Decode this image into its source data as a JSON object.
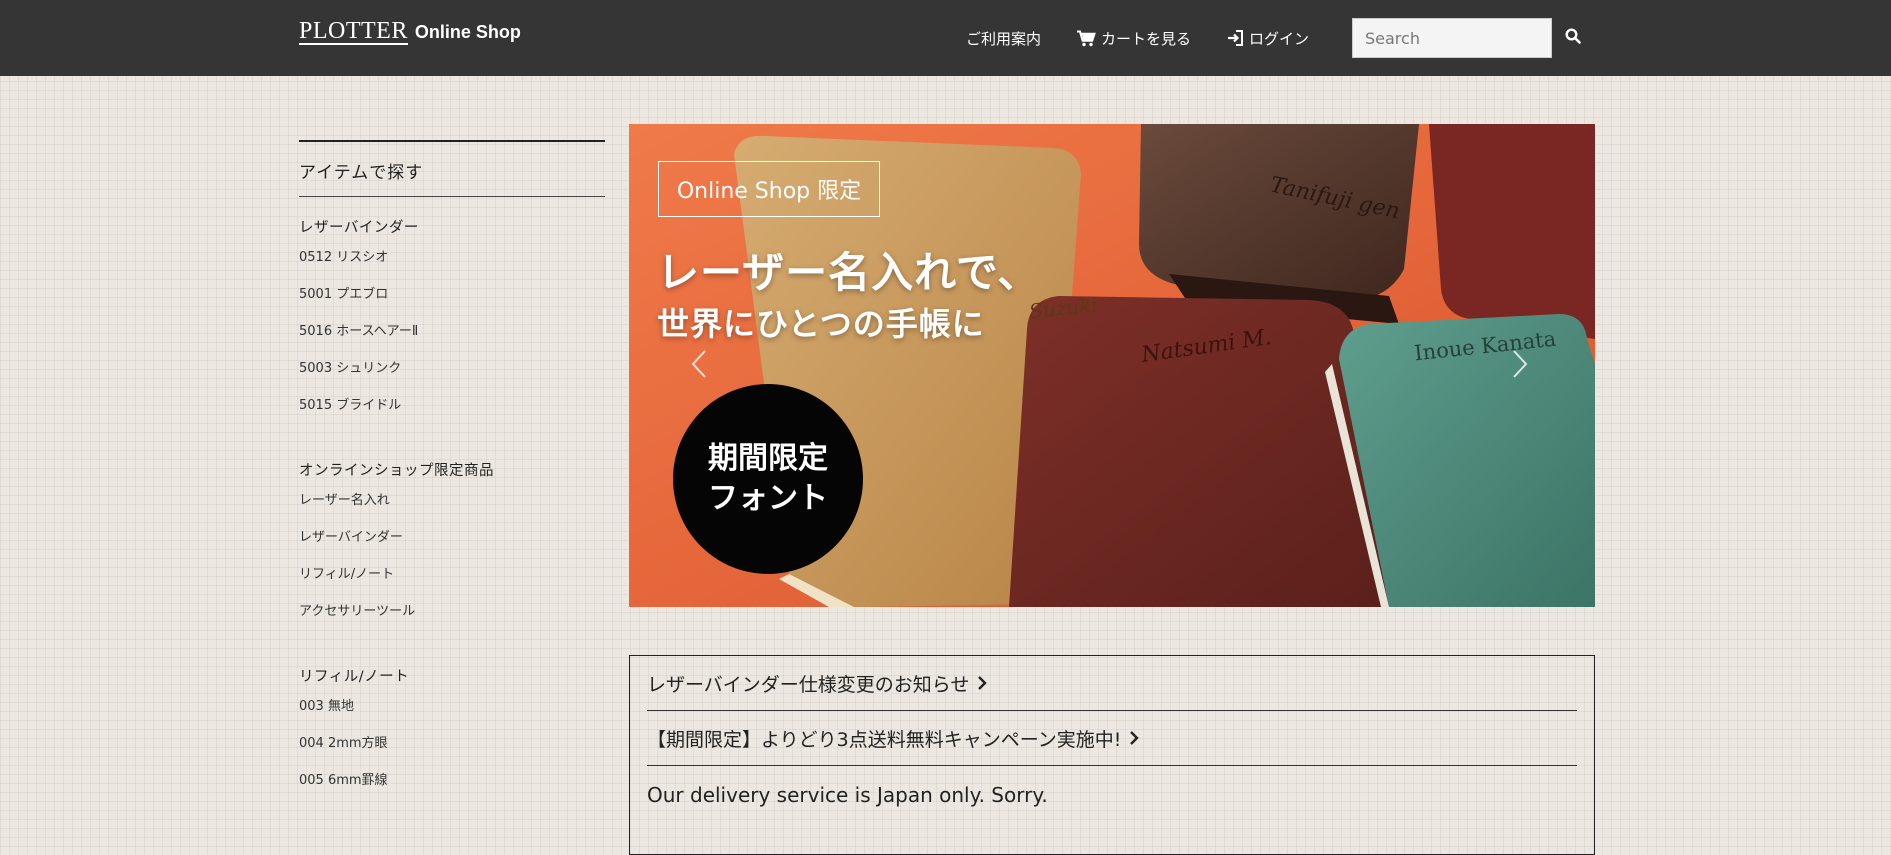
{
  "header": {
    "brand_logo": "PLOTTER",
    "brand_sub": "Online Shop",
    "nav": {
      "guide": "ご利用案内",
      "cart": "カートを見る",
      "login": "ログイン"
    },
    "search": {
      "placeholder": "Search",
      "value": ""
    },
    "icons": [
      "cart-icon",
      "login-icon",
      "search-icon"
    ]
  },
  "sidebar": {
    "title": "アイテムで探す",
    "groups": [
      {
        "title": "レザーバインダー",
        "items": [
          "0512 リスシオ",
          "5001 プエブロ",
          "5016 ホースヘアーⅡ",
          "5003 シュリンク",
          "5015 ブライドル"
        ]
      },
      {
        "title": "オンラインショップ限定商品",
        "items": [
          "レーザー名入れ",
          "レザーバインダー",
          "リフィル/ノート",
          "アクセサリーツール"
        ]
      },
      {
        "title": "リフィル/ノート",
        "items": [
          "003 無地",
          "004 2mm方眼",
          "005 6mm罫線"
        ]
      }
    ]
  },
  "banner": {
    "badge": "Online Shop 限定",
    "headline1": "レーザー名入れで、",
    "headline2": "世界にひとつの手帳に",
    "circle_line1": "期間限定",
    "circle_line2": "フォント",
    "engravings": [
      "Tanifuji gen",
      "Suzuki",
      "Natsumi M.",
      "Inoue Kanata"
    ],
    "colors": {
      "background": "#e8663a",
      "tan": "#c89a5e",
      "brown": "#6e2a22",
      "teal": "#4f8f80",
      "dark_brown": "#5a3a2e"
    }
  },
  "news": {
    "items": [
      "レザーバインダー仕様変更のお知らせ",
      "【期間限定】よりどり3点送料無料キャンペーン実施中!"
    ],
    "note": "Our delivery service is Japan only. Sorry."
  },
  "colors": {
    "header_bg": "#353535",
    "page_bg": "#ece8e1"
  }
}
